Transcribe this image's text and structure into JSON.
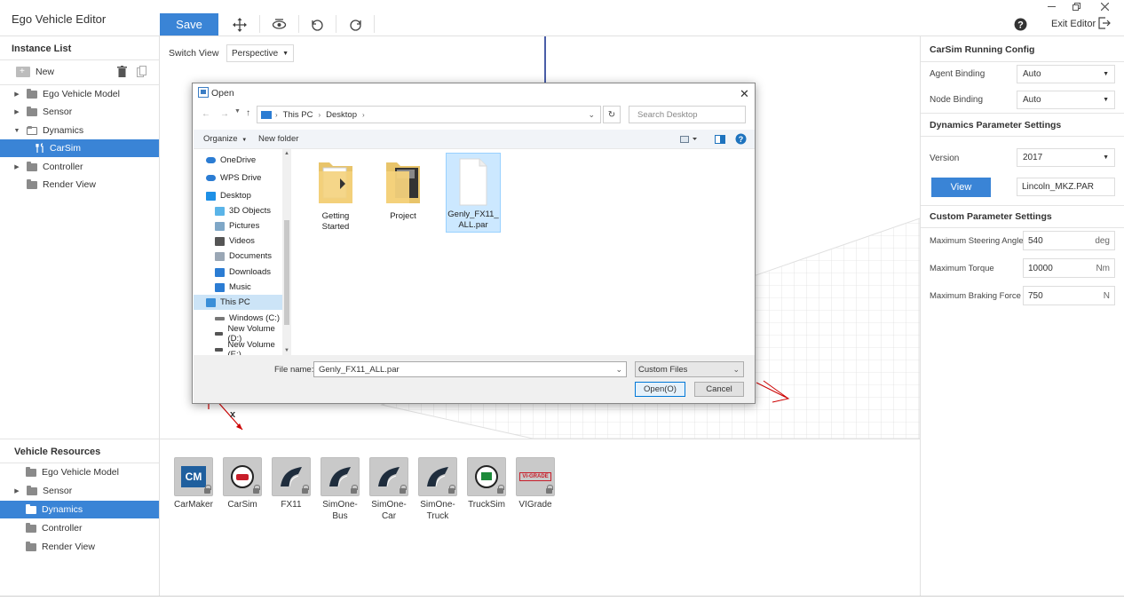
{
  "app": {
    "title": "Ego Vehicle Editor",
    "save_label": "Save",
    "exit_label": "Exit Editor"
  },
  "instance_list": {
    "title": "Instance List",
    "new_label": "New",
    "items": [
      {
        "label": "Ego Vehicle Model",
        "icon": "folder-icon",
        "caret": "right"
      },
      {
        "label": "Sensor",
        "icon": "folder-icon",
        "caret": "right"
      },
      {
        "label": "Dynamics",
        "icon": "folder-open-icon",
        "caret": "down"
      },
      {
        "label": "CarSim",
        "icon": "tools-icon",
        "selected": true
      },
      {
        "label": "Controller",
        "icon": "folder-icon",
        "caret": "right"
      },
      {
        "label": "Render View",
        "icon": "folder-icon"
      }
    ]
  },
  "viewport": {
    "switch_view_label": "Switch View",
    "view_mode": "Perspective",
    "axis_x_label": "x"
  },
  "vehicle_resources": {
    "title": "Vehicle Resources",
    "items": [
      {
        "label": "Ego Vehicle Model"
      },
      {
        "label": "Sensor",
        "caret": "right"
      },
      {
        "label": "Dynamics",
        "selected": true
      },
      {
        "label": "Controller"
      },
      {
        "label": "Render View"
      }
    ],
    "cards": [
      {
        "label_line1": "CarMaker",
        "label_line2": "",
        "icon": "carmaker-icon",
        "badge": "CM"
      },
      {
        "label_line1": "CarSim",
        "label_line2": "",
        "icon": "carsim-icon"
      },
      {
        "label_line1": "FX11",
        "label_line2": "",
        "icon": "road-icon"
      },
      {
        "label_line1": "SimOne-",
        "label_line2": "Bus",
        "icon": "road-icon"
      },
      {
        "label_line1": "SimOne-",
        "label_line2": "Car",
        "icon": "road-icon"
      },
      {
        "label_line1": "SimOne-",
        "label_line2": "Truck",
        "icon": "road-icon"
      },
      {
        "label_line1": "TruckSim",
        "label_line2": "",
        "icon": "trucksim-icon"
      },
      {
        "label_line1": "VIGrade",
        "label_line2": "",
        "icon": "vigrade-icon",
        "badge": "VI-GRADE"
      }
    ]
  },
  "right_panel": {
    "carsim_title": "CarSim Running Config",
    "agent_binding_label": "Agent Binding",
    "agent_binding_value": "Auto",
    "node_binding_label": "Node Binding",
    "node_binding_value": "Auto",
    "dynamics_title": "Dynamics Parameter Settings",
    "version_label": "Version",
    "version_value": "2017",
    "view_label": "View",
    "par_file": "Lincoln_MKZ.PAR",
    "custom_title": "Custom Parameter Settings",
    "steering_label": "Maximum Steering Angle",
    "steering_value": "540",
    "steering_unit": "deg",
    "torque_label": "Maximum Torque",
    "torque_value": "10000",
    "torque_unit": "Nm",
    "braking_label": "Maximum Braking Force",
    "braking_value": "750",
    "braking_unit": "N"
  },
  "open_dialog": {
    "title": "Open",
    "breadcrumb": [
      "This PC",
      "Desktop"
    ],
    "search_placeholder": "Search Desktop",
    "organize_label": "Organize",
    "new_folder_label": "New folder",
    "nav_items": [
      {
        "label": "OneDrive",
        "icon": "onedrive-icon",
        "color": "#2b7cd3"
      },
      {
        "label": "WPS Drive",
        "icon": "wps-drive-icon",
        "color": "#2b7cd3"
      },
      {
        "label": "Desktop",
        "icon": "desktop-icon",
        "color": "#1e90e6"
      },
      {
        "label": "3D Objects",
        "icon": "3d-objects-icon",
        "color": "#5ab4e8"
      },
      {
        "label": "Pictures",
        "icon": "pictures-icon",
        "color": "#7fa7c7"
      },
      {
        "label": "Videos",
        "icon": "videos-icon",
        "color": "#555"
      },
      {
        "label": "Documents",
        "icon": "documents-icon",
        "color": "#9aa7b5"
      },
      {
        "label": "Downloads",
        "icon": "downloads-icon",
        "color": "#2b7cd3"
      },
      {
        "label": "Music",
        "icon": "music-icon",
        "color": "#2b7cd3"
      },
      {
        "label": "This PC",
        "icon": "this-pc-icon",
        "color": "#3b8fd8",
        "selected": true
      },
      {
        "label": "Windows (C:)",
        "icon": "drive-icon",
        "color": "#777"
      },
      {
        "label": "New Volume (D:)",
        "icon": "drive-icon",
        "color": "#555"
      },
      {
        "label": "New Volume (E:)",
        "icon": "drive-icon",
        "color": "#555"
      }
    ],
    "files": [
      {
        "name_line1": "Getting Started",
        "name_line2": "",
        "type": "folder"
      },
      {
        "name_line1": "Project",
        "name_line2": "",
        "type": "folder"
      },
      {
        "name_line1": "Genly_FX11_",
        "name_line2": "ALL.par",
        "type": "file",
        "selected": true
      }
    ],
    "file_name_label": "File name:",
    "file_name_value": "Genly_FX11_ALL.par",
    "file_type_value": "Custom Files",
    "open_button": "Open(O)",
    "cancel_button": "Cancel"
  },
  "colors": {
    "accent": "#3a84d6",
    "selection": "#cce4f7"
  }
}
